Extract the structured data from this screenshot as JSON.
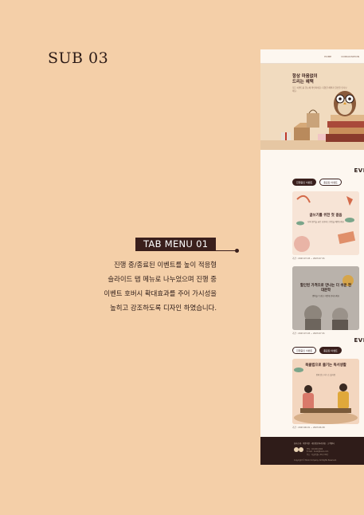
{
  "page": {
    "title": "SUB 03",
    "tab_badge": "TAB MENU 01",
    "description": [
      "진행 중/종료된 이벤트를 높이 적응형",
      "슬라이드 탭 메뉴로 나누었으며 진행 중",
      "이벤트 호버시 확대효과를 주어 가시성을",
      "높히고 강조하도록 디자인 하였습니다."
    ]
  },
  "colors": {
    "background": "#f4cfa8",
    "accent": "#3a1f1c"
  },
  "site": {
    "nav": [
      "HOME",
      "CONSULTATION"
    ],
    "hero": {
      "title_line1": "항상 마음없이",
      "title_line2": "드리는 혜택",
      "subtitle": "모든 이벤트를 한눈에 확인하세요. 다양한 혜택과 할인을 만나보세요."
    },
    "section1": {
      "heading": "EVE",
      "tabs": [
        "진행중인 이벤트",
        "종료된 이벤트"
      ],
      "cards": [
        {
          "title": "글쓰기를 위한 첫 걸음",
          "body": "나의 생각을 글로 표현하는 방법을 배워보세요",
          "caption": "기간 : 2023.07.03 ~ 2023.07.31"
        },
        {
          "title": "할인된 가격으로 만나는 더 쉬운 현대문학",
          "body": "명작을 더 쉽고 가깝게 만나보세요",
          "caption": "기간 : 2023.07.03 ~ 2023.07.31"
        }
      ]
    },
    "section2": {
      "heading": "EVE",
      "tabs": [
        "진행중인 이벤트",
        "종료된 이벤트"
      ],
      "cards": [
        {
          "title": "북클럽으로 즐기는 독서생활",
          "body": "함께 읽고 나누는 즐거움",
          "caption": "기간 : 2023.06.01 ~ 2023.06.30"
        }
      ]
    },
    "footer": {
      "links": "회사소개 · 이용약관 · 개인정보처리방침 · 고객센터",
      "info": [
        "TEL : 02-000-0000",
        "E-mail : book@book.com",
        "주소 : 서울특별시 00구 00로"
      ],
      "copyright": "Copyright © Book Company. All Rights Reserved."
    }
  }
}
